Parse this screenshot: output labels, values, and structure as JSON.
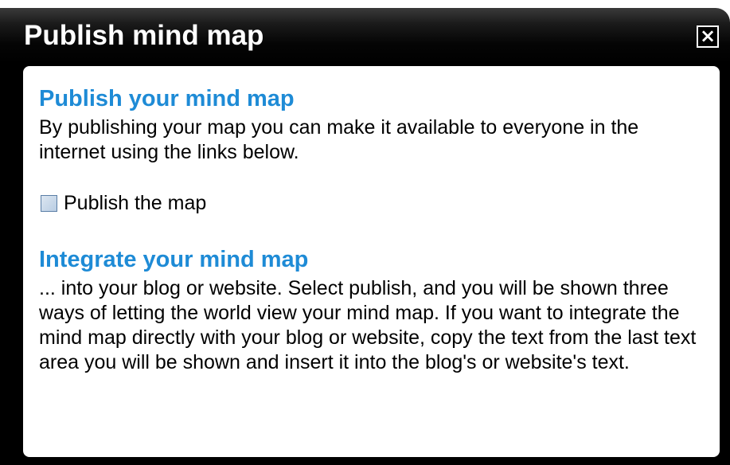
{
  "dialog": {
    "title": "Publish mind map",
    "close_label": "×"
  },
  "publish_section": {
    "heading": "Publish your mind map",
    "description": "By publishing your map you can make it available to everyone in the internet using the links below.",
    "checkbox_label": "Publish the map",
    "checkbox_checked": false
  },
  "integrate_section": {
    "heading": "Integrate your mind map",
    "description": "... into your blog or website. Select publish, and you will be shown three ways of letting the world view your mind map. If you want to integrate the mind map directly with your blog or website, copy the text from the last text area you will be shown and insert it into the blog's or website's text."
  },
  "colors": {
    "heading": "#1e8bd6",
    "title_bar": "#000000",
    "panel": "#ffffff"
  }
}
